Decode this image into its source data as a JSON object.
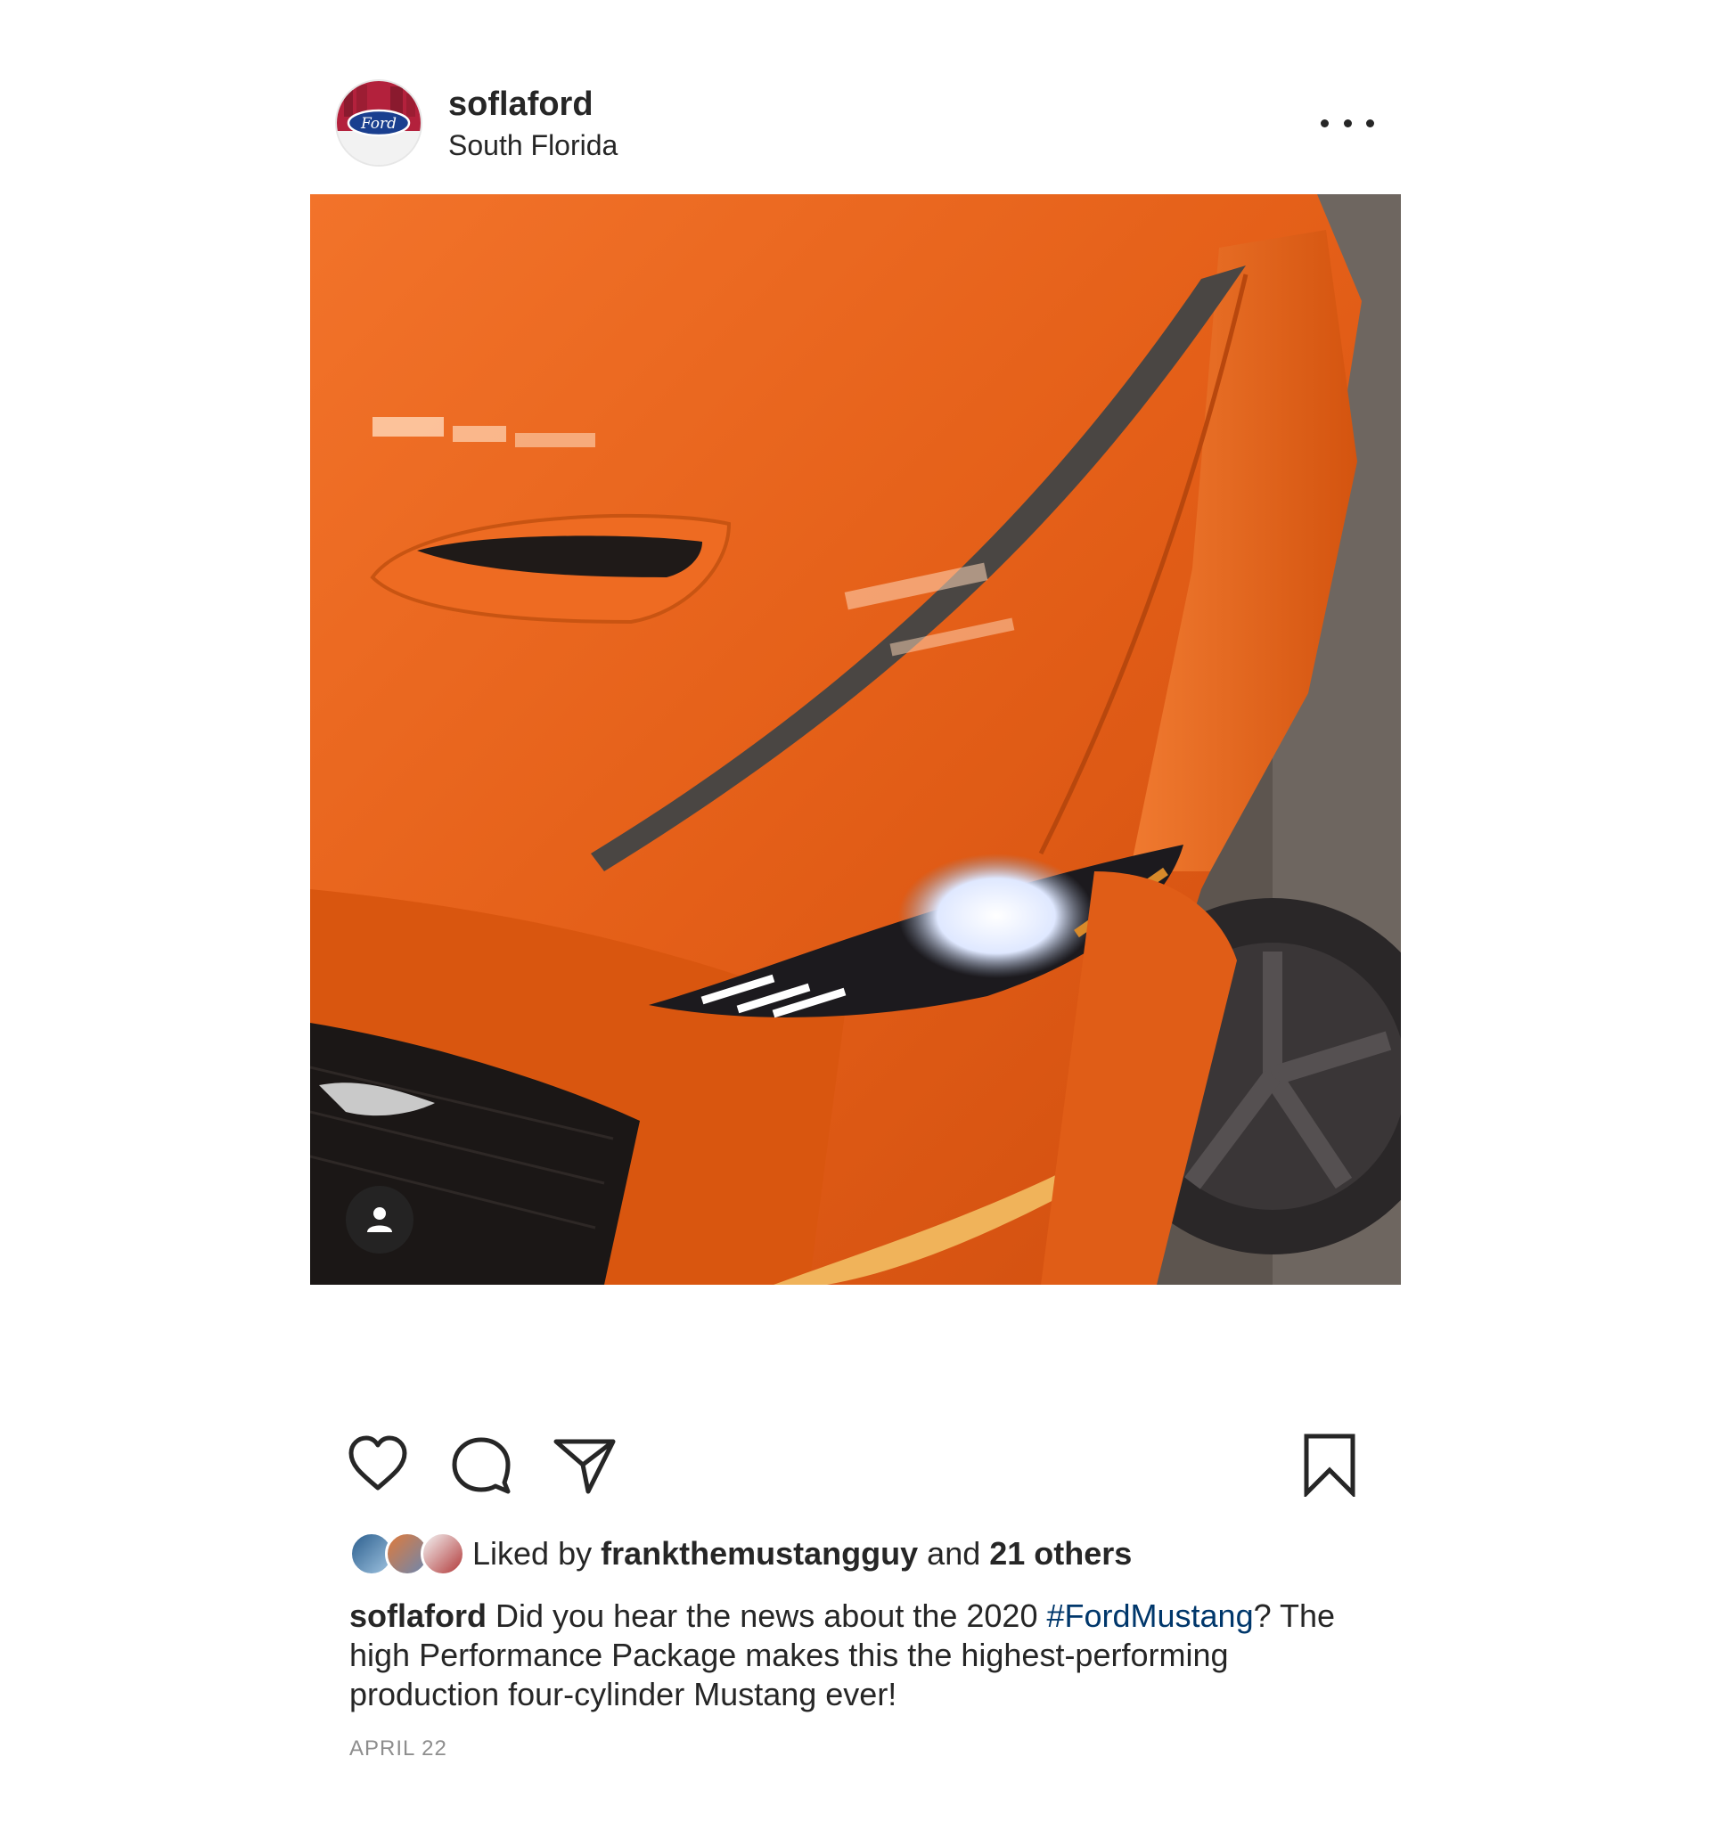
{
  "header": {
    "username": "soflaford",
    "location": "South Florida",
    "avatar_icon": "ford-logo-icon",
    "more_icon": "more-options-icon"
  },
  "post_image": {
    "subject_icon": "car-photo",
    "tag_icon": "user-tag-icon"
  },
  "actions": {
    "like_icon": "heart-icon",
    "comment_icon": "comment-icon",
    "share_icon": "paper-plane-icon",
    "save_icon": "bookmark-icon"
  },
  "likes": {
    "prefix": "Liked by",
    "user": "frankthemustangguy",
    "conjunction": "and",
    "others": "21 others"
  },
  "caption": {
    "username": "soflaford",
    "text_before": "Did you hear the news about the 2020",
    "hashtag": "#FordMustang",
    "text_after": "? The high Performance Package makes this the highest-performing production four-cylinder Mustang ever!"
  },
  "date": "APRIL 22",
  "colors": {
    "text": "#262626",
    "muted": "#8e8e8e",
    "hashtag": "#00376b",
    "car_orange": "#e8651d"
  }
}
